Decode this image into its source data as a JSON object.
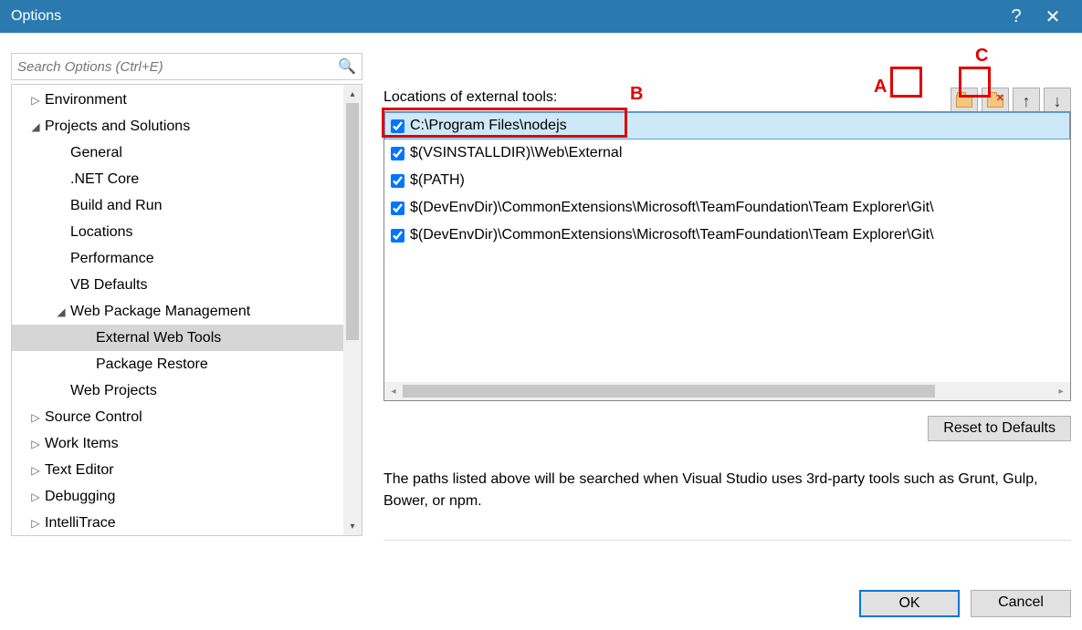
{
  "window": {
    "title": "Options"
  },
  "search": {
    "placeholder": "Search Options (Ctrl+E)"
  },
  "tree": [
    {
      "label": "Environment",
      "depth": 0,
      "expander": "▷",
      "selected": false
    },
    {
      "label": "Projects and Solutions",
      "depth": 0,
      "expander": "◢",
      "selected": false
    },
    {
      "label": "General",
      "depth": 1,
      "expander": "",
      "selected": false
    },
    {
      "label": ".NET Core",
      "depth": 1,
      "expander": "",
      "selected": false
    },
    {
      "label": "Build and Run",
      "depth": 1,
      "expander": "",
      "selected": false
    },
    {
      "label": "Locations",
      "depth": 1,
      "expander": "",
      "selected": false
    },
    {
      "label": "Performance",
      "depth": 1,
      "expander": "",
      "selected": false
    },
    {
      "label": "VB Defaults",
      "depth": 1,
      "expander": "",
      "selected": false
    },
    {
      "label": "Web Package Management",
      "depth": 1,
      "expander": "◢",
      "selected": false
    },
    {
      "label": "External Web Tools",
      "depth": 2,
      "expander": "",
      "selected": true
    },
    {
      "label": "Package Restore",
      "depth": 2,
      "expander": "",
      "selected": false
    },
    {
      "label": "Web Projects",
      "depth": 1,
      "expander": "",
      "selected": false
    },
    {
      "label": "Source Control",
      "depth": 0,
      "expander": "▷",
      "selected": false
    },
    {
      "label": "Work Items",
      "depth": 0,
      "expander": "▷",
      "selected": false
    },
    {
      "label": "Text Editor",
      "depth": 0,
      "expander": "▷",
      "selected": false
    },
    {
      "label": "Debugging",
      "depth": 0,
      "expander": "▷",
      "selected": false
    },
    {
      "label": "IntelliTrace",
      "depth": 0,
      "expander": "▷",
      "selected": false
    }
  ],
  "section_label": "Locations of external tools:",
  "list": [
    {
      "checked": true,
      "path": "C:\\Program Files\\nodejs",
      "selected": true
    },
    {
      "checked": true,
      "path": "$(VSINSTALLDIR)\\Web\\External",
      "selected": false
    },
    {
      "checked": true,
      "path": "$(PATH)",
      "selected": false
    },
    {
      "checked": true,
      "path": "$(DevEnvDir)\\CommonExtensions\\Microsoft\\TeamFoundation\\Team Explorer\\Git\\",
      "selected": false
    },
    {
      "checked": true,
      "path": "$(DevEnvDir)\\CommonExtensions\\Microsoft\\TeamFoundation\\Team Explorer\\Git\\",
      "selected": false
    }
  ],
  "buttons": {
    "reset": "Reset to Defaults",
    "ok": "OK",
    "cancel": "Cancel"
  },
  "description": "The paths listed above will be searched when Visual Studio uses 3rd-party tools such as Grunt, Gulp, Bower, or npm.",
  "annotations": {
    "a": "A",
    "b": "B",
    "c": "C"
  }
}
